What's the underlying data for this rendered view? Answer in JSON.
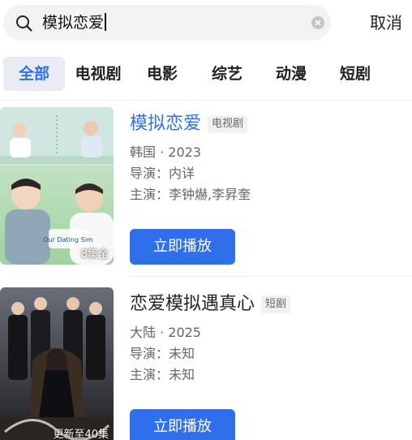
{
  "search": {
    "query": "模拟恋爱",
    "cancel_label": "取消"
  },
  "tabs": [
    {
      "label": "全部",
      "active": true
    },
    {
      "label": "电视剧",
      "active": false
    },
    {
      "label": "电影",
      "active": false
    },
    {
      "label": "综艺",
      "active": false
    },
    {
      "label": "动漫",
      "active": false
    },
    {
      "label": "短剧",
      "active": false
    }
  ],
  "results": [
    {
      "title": "模拟恋爱",
      "tag": "电视剧",
      "region_year": "韩国 · 2023",
      "director": "导演：内详",
      "cast": "主演：李钟爀,李昇奎",
      "poster_badge": "8集全",
      "poster_text": "Our Dating Sim",
      "play_label": "立即播放"
    },
    {
      "title": "恋爱模拟遇真心",
      "tag": "短剧",
      "region_year": "大陆 · 2025",
      "director": "导演：未知",
      "cast": "主演：未知",
      "poster_badge": "更新至40集",
      "play_label": "立即播放"
    }
  ],
  "colors": {
    "accent": "#2f6fec",
    "tab_active_bg": "#e9ecf2",
    "search_bg": "#f2f3f5"
  },
  "icons": {
    "search": "search-icon",
    "clear": "clear-icon"
  }
}
